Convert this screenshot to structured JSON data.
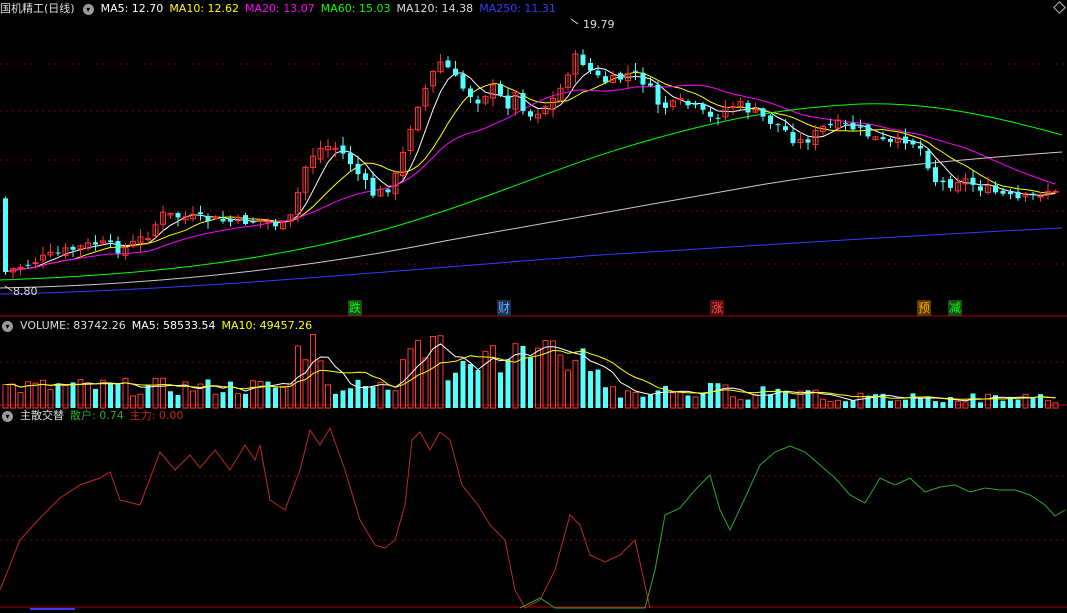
{
  "stock": {
    "name": "国机精工",
    "period": "(日线)"
  },
  "ma": [
    {
      "label": "MA5: 12.70",
      "color": "#ffffff"
    },
    {
      "label": "MA10: 12.62",
      "color": "#ffff00"
    },
    {
      "label": "MA20: 13.07",
      "color": "#ff00ff"
    },
    {
      "label": "MA60: 15.03",
      "color": "#00ff00"
    },
    {
      "label": "MA120: 14.38",
      "color": "#dddddd"
    },
    {
      "label": "MA250: 11.31",
      "color": "#3a3aff"
    }
  ],
  "price_annotations": {
    "high": "19.79",
    "low": "8.80"
  },
  "events": [
    {
      "text": "跌",
      "bg": "#1c4a1c",
      "color": "#00ff00"
    },
    {
      "text": "财",
      "bg": "#1a3050",
      "color": "#66aaff"
    },
    {
      "text": "涨",
      "bg": "#5a1010",
      "color": "#ff4444"
    },
    {
      "text": "预",
      "bg": "#5a3a00",
      "color": "#ffaa00"
    },
    {
      "text": "减",
      "bg": "#1c4a1c",
      "color": "#00ff00"
    }
  ],
  "volume": {
    "title": "VOLUME: 83742.26",
    "ma5": "MA5: 58533.54",
    "ma10": "MA10: 49457.26"
  },
  "indicator": {
    "title": "主散交替",
    "retail": "散户: 0.74",
    "main": "主力: 0.00"
  },
  "colors": {
    "up": "#ff3232",
    "down": "#54ffff",
    "grid": "#7a0000",
    "separator": "#b00000",
    "retail_line": "#2ea82e",
    "main_line": "#c02828"
  }
}
